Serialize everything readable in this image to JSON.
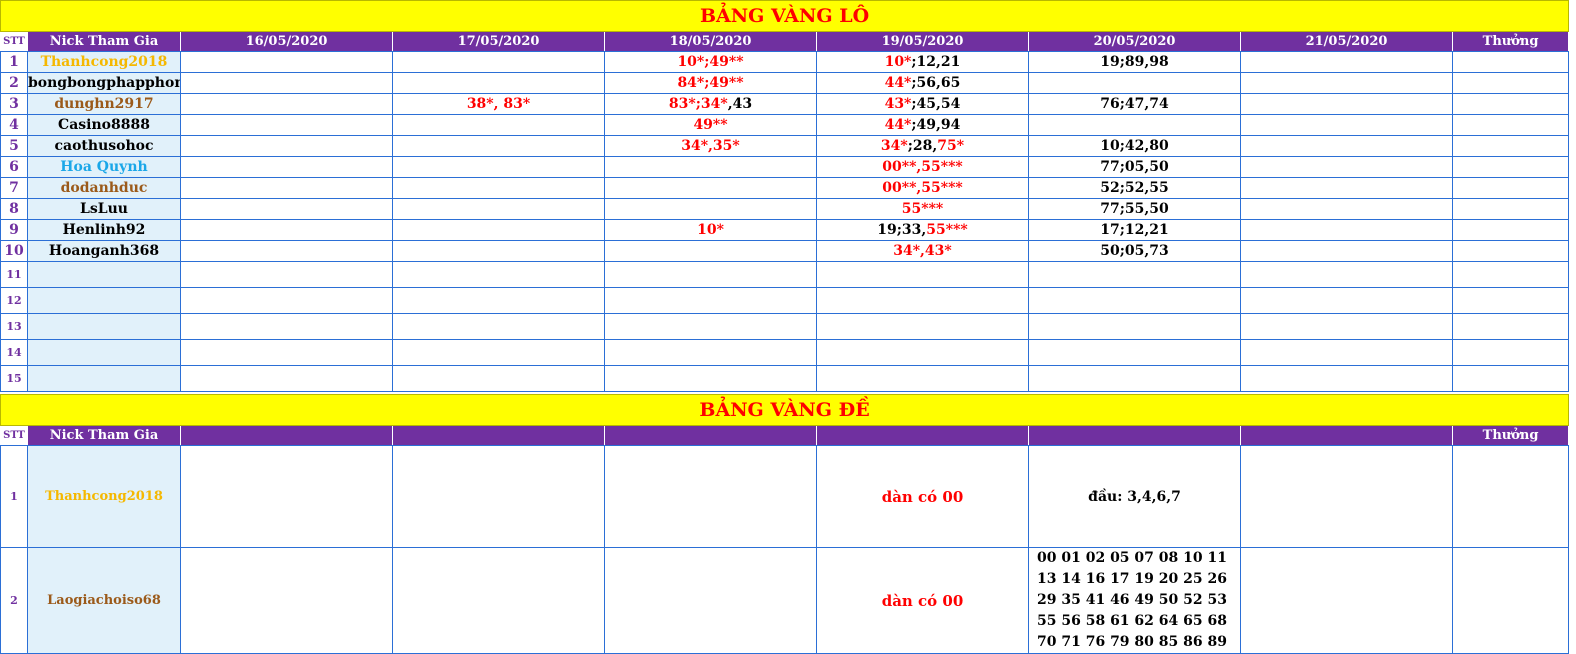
{
  "lo": {
    "title": "BẢNG VÀNG LÔ",
    "headers": {
      "stt": "STT",
      "nick": "Nick Tham Gia",
      "dates": [
        "16/05/2020",
        "17/05/2020",
        "18/05/2020",
        "19/05/2020",
        "20/05/2020",
        "21/05/2020"
      ],
      "reward": "Thưởng"
    },
    "rows": [
      {
        "stt": "1",
        "nick": "Thanhcong2018",
        "nick_color": "orange",
        "cells": [
          "",
          "",
          [
            [
              "10*;49**",
              "red"
            ]
          ],
          [
            [
              "10*",
              "red"
            ],
            [
              ";12,21",
              "blk"
            ]
          ],
          [
            [
              "19;89,98",
              "blk"
            ]
          ],
          ""
        ]
      },
      {
        "stt": "2",
        "nick": "bongbongphapphong",
        "nick_color": "black",
        "cells": [
          "",
          "",
          [
            [
              "84*;49**",
              "red"
            ]
          ],
          [
            [
              "44*",
              "red"
            ],
            [
              ";56,65",
              "blk"
            ]
          ],
          "",
          ""
        ]
      },
      {
        "stt": "3",
        "nick": "dunghn2917",
        "nick_color": "brown",
        "cells": [
          "",
          [
            [
              "38*, 83*",
              "red"
            ]
          ],
          [
            [
              "83*;34*",
              "red"
            ],
            [
              ",43",
              "blk"
            ]
          ],
          [
            [
              "43*",
              "red"
            ],
            [
              ";45,54",
              "blk"
            ]
          ],
          [
            [
              "76;47,74",
              "blk"
            ]
          ],
          ""
        ]
      },
      {
        "stt": "4",
        "nick": "Casino8888",
        "nick_color": "black",
        "cells": [
          "",
          "",
          [
            [
              "49**",
              "red"
            ]
          ],
          [
            [
              "44*",
              "red"
            ],
            [
              ";49,94",
              "blk"
            ]
          ],
          "",
          ""
        ]
      },
      {
        "stt": "5",
        "nick": "caothusohoc",
        "nick_color": "black",
        "cells": [
          "",
          "",
          [
            [
              "34*,35*",
              "red"
            ]
          ],
          [
            [
              "34*",
              "red"
            ],
            [
              ";28,",
              "blk"
            ],
            [
              "75*",
              "red"
            ]
          ],
          [
            [
              "10;42,80",
              "blk"
            ]
          ],
          ""
        ]
      },
      {
        "stt": "6",
        "nick": "Hoa Quynh",
        "nick_color": "sky",
        "cells": [
          "",
          "",
          "",
          [
            [
              "00**,55***",
              "red"
            ]
          ],
          [
            [
              "77;05,50",
              "blk"
            ]
          ],
          ""
        ]
      },
      {
        "stt": "7",
        "nick": "dodanhduc",
        "nick_color": "brown",
        "cells": [
          "",
          "",
          "",
          [
            [
              "00**,55***",
              "red"
            ]
          ],
          [
            [
              "52;52,55",
              "blk"
            ]
          ],
          ""
        ]
      },
      {
        "stt": "8",
        "nick": "LsLuu",
        "nick_color": "black",
        "cells": [
          "",
          "",
          "",
          [
            [
              "55***",
              "red"
            ]
          ],
          [
            [
              "77;55,50",
              "blk"
            ]
          ],
          ""
        ]
      },
      {
        "stt": "9",
        "nick": "Henlinh92",
        "nick_color": "black",
        "cells": [
          "",
          "",
          [
            [
              "10*",
              "red"
            ]
          ],
          [
            [
              "19;33,",
              "blk"
            ],
            [
              "55***",
              "red"
            ]
          ],
          [
            [
              "17;12,21",
              "blk"
            ]
          ],
          ""
        ]
      },
      {
        "stt": "10",
        "nick": "Hoanganh368",
        "nick_color": "black",
        "cells": [
          "",
          "",
          "",
          [
            [
              "34*,43*",
              "red"
            ]
          ],
          [
            [
              "50;05,73",
              "blk"
            ]
          ],
          ""
        ]
      }
    ],
    "empty_rows": [
      "11",
      "12",
      "13",
      "14",
      "15"
    ]
  },
  "de": {
    "title": "BẢNG VÀNG ĐỀ",
    "headers": {
      "stt": "STT",
      "nick": "Nick Tham Gia",
      "reward": "Thưởng"
    },
    "rows": [
      {
        "stt": "1",
        "nick": "Thanhcong2018",
        "nick_color": "orange",
        "col19": "dàn có 00",
        "col20": "đầu: 3,4,6,7"
      },
      {
        "stt": "2",
        "nick": "Laogiachoiso68",
        "nick_color": "brown",
        "col19": "dàn có 00",
        "col20": "00 01 02 05 07 08 10 11 13 14 16 17 19 20 25 26 29 35 41 46 49 50 52 53 55 56 58 61 62 64 65 68 70 71 76 79 80 85 86 89"
      }
    ]
  },
  "colors": {
    "title_bg": "#ffff00",
    "title_text": "#ff0000",
    "header_bg": "#7030a0",
    "nick_bg": "#e1f1fa",
    "grid": "#2b6fd6"
  }
}
